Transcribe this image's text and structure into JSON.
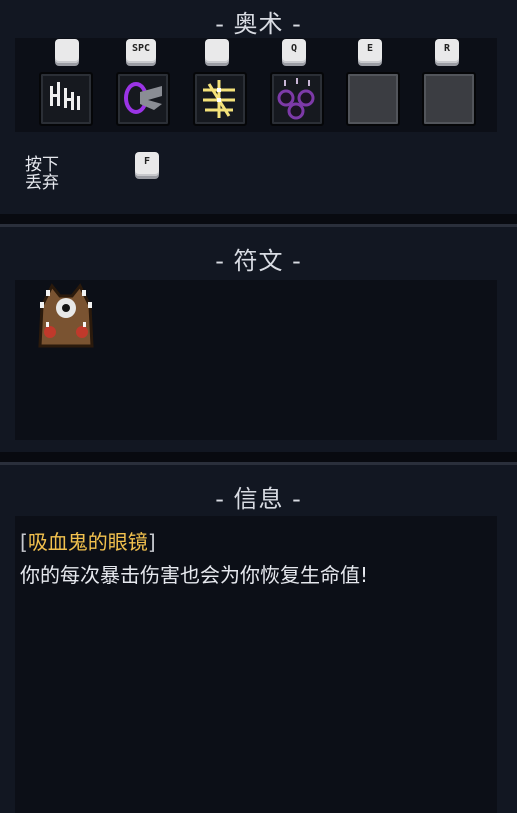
{
  "arcana": {
    "title": "- 奥术 -",
    "slots": [
      {
        "key": "",
        "icon": "claw-slash-icon",
        "empty": false
      },
      {
        "key": "SPC",
        "icon": "shadow-dash-icon",
        "empty": false
      },
      {
        "key": "",
        "icon": "lightning-cross-icon",
        "empty": false
      },
      {
        "key": "Q",
        "icon": "dark-orbs-icon",
        "empty": false
      },
      {
        "key": "E",
        "icon": "empty-slot-icon",
        "empty": true
      },
      {
        "key": "R",
        "icon": "empty-slot-icon",
        "empty": true
      }
    ],
    "discard_hint_line1": "按下",
    "discard_hint_line2": "丢弃",
    "discard_key": "F"
  },
  "relics": {
    "title": "- 符文 -",
    "items": [
      {
        "icon": "vampire-glasses-icon"
      }
    ]
  },
  "info": {
    "title": "- 信息 -",
    "bracket_open": "[",
    "item_name": "吸血鬼的眼镜",
    "bracket_close": "]",
    "description": "你的每次暴击伤害也会为你恢复生命值!"
  },
  "colors": {
    "background": "#121722",
    "item_name": "#f2c14e"
  }
}
